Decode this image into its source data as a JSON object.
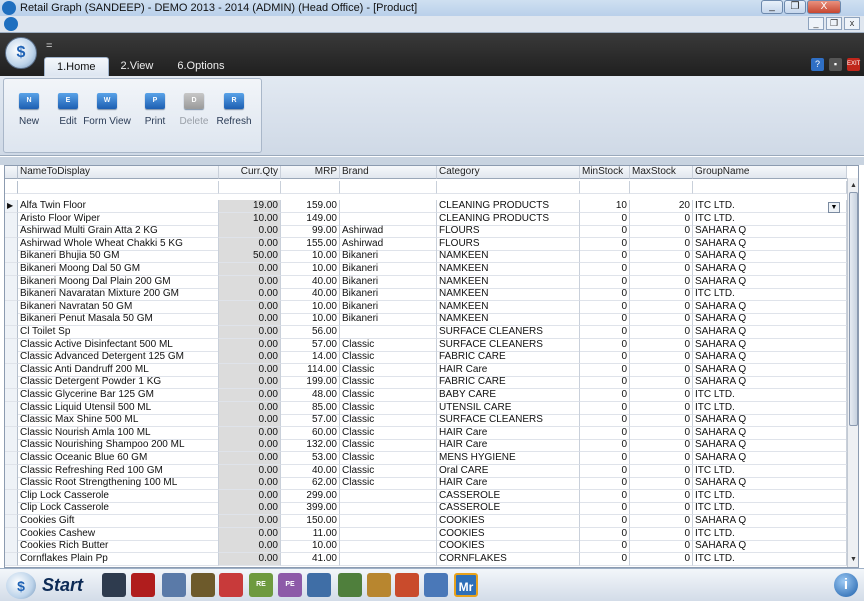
{
  "window": {
    "title": "Retail Graph (SANDEEP) - DEMO  2013 - 2014 (ADMIN) (Head Office)  - [Product]",
    "min": "_",
    "max": "❐",
    "close": "X"
  },
  "mdi": {
    "min": "_",
    "restore": "❐",
    "close": "x"
  },
  "qat_symbol": "=",
  "logo_glyph": "$",
  "tabs": [
    "1.Home",
    "2.View",
    "6.Options"
  ],
  "help_buttons": [
    {
      "icon": "help-icon",
      "glyph": "?",
      "color": "#2f6fc5"
    },
    {
      "icon": "save-icon",
      "glyph": "▪",
      "color": "#555555"
    },
    {
      "icon": "exit-icon",
      "glyph": "EXIT",
      "color": "#c0261b"
    }
  ],
  "ribbon_buttons": [
    {
      "name": "new",
      "label": "New",
      "glyph": "N",
      "enabled": true
    },
    {
      "name": "edit",
      "label": "Edit",
      "glyph": "E",
      "enabled": true
    },
    {
      "name": "form-view",
      "label": "Form View",
      "glyph": "W",
      "enabled": true
    },
    {
      "name": "print",
      "label": "Print",
      "glyph": "P",
      "enabled": true
    },
    {
      "name": "delete",
      "label": "Delete",
      "glyph": "D",
      "enabled": false
    },
    {
      "name": "refresh",
      "label": "Refresh",
      "glyph": "R",
      "enabled": true
    }
  ],
  "columns": [
    "NameToDisplay",
    "Curr.Qty",
    "MRP",
    "Brand",
    "Category",
    "MinStock",
    "MaxStock",
    "GroupName"
  ],
  "rows": [
    [
      "Alfa Twin Floor",
      "19.00",
      "159.00",
      "",
      "CLEANING PRODUCTS",
      "10",
      "20",
      "ITC LTD."
    ],
    [
      "Aristo Floor Wiper",
      "10.00",
      "149.00",
      "",
      "CLEANING PRODUCTS",
      "0",
      "0",
      "ITC LTD."
    ],
    [
      "Ashirwad Multi Grain Atta 2 KG",
      "0.00",
      "99.00",
      "Ashirwad",
      "FLOURS",
      "0",
      "0",
      "SAHARA Q"
    ],
    [
      "Ashirwad Whole Wheat Chakki 5 KG",
      "0.00",
      "155.00",
      "Ashirwad",
      "FLOURS",
      "0",
      "0",
      "SAHARA Q"
    ],
    [
      "Bikaneri Bhujia 50 GM",
      "50.00",
      "10.00",
      "Bikaneri",
      "NAMKEEN",
      "0",
      "0",
      "SAHARA Q"
    ],
    [
      "Bikaneri Moong Dal 50 GM",
      "0.00",
      "10.00",
      "Bikaneri",
      "NAMKEEN",
      "0",
      "0",
      "SAHARA Q"
    ],
    [
      "Bikaneri Moong Dal Plain 200 GM",
      "0.00",
      "40.00",
      "Bikaneri",
      "NAMKEEN",
      "0",
      "0",
      "SAHARA Q"
    ],
    [
      "Bikaneri Navaratan Mixture 200 GM",
      "0.00",
      "40.00",
      "Bikaneri",
      "NAMKEEN",
      "0",
      "0",
      "ITC LTD."
    ],
    [
      "Bikaneri Navratan 50 GM",
      "0.00",
      "10.00",
      "Bikaneri",
      "NAMKEEN",
      "0",
      "0",
      "SAHARA Q"
    ],
    [
      "Bikaneri Penut Masala 50 GM",
      "0.00",
      "10.00",
      "Bikaneri",
      "NAMKEEN",
      "0",
      "0",
      "SAHARA Q"
    ],
    [
      "Cl Toilet Sp",
      "0.00",
      "56.00",
      "",
      "SURFACE CLEANERS",
      "0",
      "0",
      "SAHARA Q"
    ],
    [
      "Classic Active Disinfectant 500 ML",
      "0.00",
      "57.00",
      "Classic",
      "SURFACE CLEANERS",
      "0",
      "0",
      "SAHARA Q"
    ],
    [
      "Classic Advanced Detergent 125 GM",
      "0.00",
      "14.00",
      "Classic",
      "FABRIC CARE",
      "0",
      "0",
      "SAHARA Q"
    ],
    [
      "Classic Anti Dandruff 200 ML",
      "0.00",
      "114.00",
      "Classic",
      "HAIR Care",
      "0",
      "0",
      "SAHARA Q"
    ],
    [
      "Classic Detergent Powder 1 KG",
      "0.00",
      "199.00",
      "Classic",
      "FABRIC CARE",
      "0",
      "0",
      "SAHARA Q"
    ],
    [
      "Classic Glycerine Bar 125 GM",
      "0.00",
      "48.00",
      "Classic",
      "BABY CARE",
      "0",
      "0",
      "ITC LTD."
    ],
    [
      "Classic Liquid Utensil 500 ML",
      "0.00",
      "85.00",
      "Classic",
      "UTENSIL CARE",
      "0",
      "0",
      "ITC LTD."
    ],
    [
      "Classic Max Shine 500 ML",
      "0.00",
      "57.00",
      "Classic",
      "SURFACE CLEANERS",
      "0",
      "0",
      "SAHARA Q"
    ],
    [
      "Classic Nourish Amla 100 ML",
      "0.00",
      "60.00",
      "Classic",
      "HAIR Care",
      "0",
      "0",
      "SAHARA Q"
    ],
    [
      "Classic Nourishing Shampoo 200 ML",
      "0.00",
      "132.00",
      "Classic",
      "HAIR Care",
      "0",
      "0",
      "SAHARA Q"
    ],
    [
      "Classic Oceanic Blue 60 GM",
      "0.00",
      "53.00",
      "Classic",
      "MENS HYGIENE",
      "0",
      "0",
      "SAHARA Q"
    ],
    [
      "Classic Refreshing Red 100 GM",
      "0.00",
      "40.00",
      "Classic",
      "Oral CARE",
      "0",
      "0",
      "ITC LTD."
    ],
    [
      "Classic Root Strengthening 100 ML",
      "0.00",
      "62.00",
      "Classic",
      "HAIR Care",
      "0",
      "0",
      "SAHARA Q"
    ],
    [
      "Clip Lock Casserole",
      "0.00",
      "299.00",
      "",
      "CASSEROLE",
      "0",
      "0",
      "ITC LTD."
    ],
    [
      "Clip Lock  Casserole",
      "0.00",
      "399.00",
      "",
      "CASSEROLE",
      "0",
      "0",
      "ITC LTD."
    ],
    [
      "Cookies  Gift",
      "0.00",
      "150.00",
      "",
      "COOKIES",
      "0",
      "0",
      "SAHARA Q"
    ],
    [
      "Cookies Cashew",
      "0.00",
      "11.00",
      "",
      "COOKIES",
      "0",
      "0",
      "ITC LTD."
    ],
    [
      "Cookies Rich Butter",
      "0.00",
      "10.00",
      "",
      "COOKIES",
      "0",
      "0",
      "SAHARA Q"
    ],
    [
      "Cornflakes Plain Pp",
      "0.00",
      "41.00",
      "",
      "CORNFLAKES",
      "0",
      "0",
      "ITC LTD."
    ]
  ],
  "scroll": {
    "up": "▲",
    "down": "▼"
  },
  "dropdown_glyph": "▼",
  "row_pointer": "▶",
  "taskbar": {
    "start_label": "Start",
    "start_glyph": "$",
    "info_glyph": "i",
    "icons": [
      {
        "name": "phone-icon",
        "color": "#2e3b4e"
      },
      {
        "name": "red-book-icon",
        "color": "#b01d1d"
      },
      {
        "name": "stock-icon",
        "color": "#5a7aa8"
      },
      {
        "name": "dashboard-icon",
        "color": "#6d5a2b"
      },
      {
        "name": "pdf-report-icon",
        "color": "#c83a3a"
      },
      {
        "name": "re-report-icon",
        "color": "#6e9a3f",
        "text": "RE"
      },
      {
        "name": "pe-report-icon",
        "color": "#8d5aa8",
        "text": "PE"
      },
      {
        "name": "user-icon",
        "color": "#3f6ea6"
      },
      {
        "name": "transfer-icon",
        "color": "#4f7f3c"
      },
      {
        "name": "money-bag-icon",
        "color": "#b8862f"
      },
      {
        "name": "shapes-icon",
        "color": "#c94b2c"
      },
      {
        "name": "brush-icon",
        "color": "#4a78b8"
      },
      {
        "name": "mr-icon",
        "color": "#2e6fb8",
        "text": "Mr"
      }
    ]
  }
}
